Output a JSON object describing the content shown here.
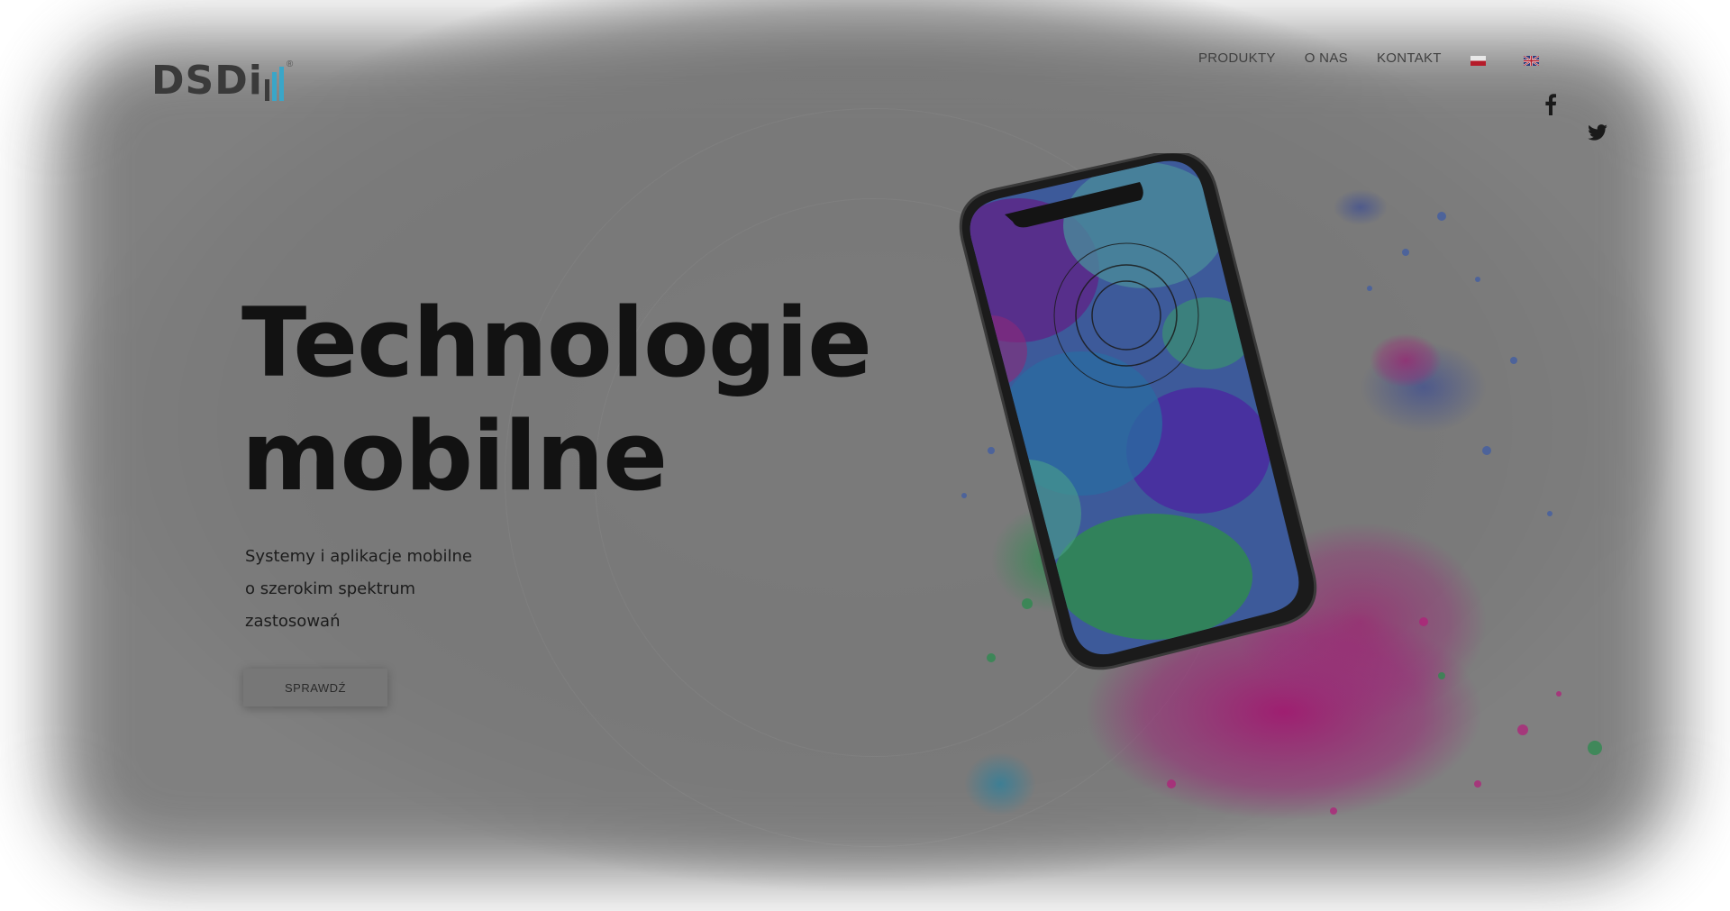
{
  "brand": {
    "logo_text": "DSDi",
    "reg_mark": "®"
  },
  "nav": {
    "items": [
      {
        "label": "PRODUKTY"
      },
      {
        "label": "O NAS"
      },
      {
        "label": "KONTAKT"
      }
    ],
    "languages": [
      "pl-flag-icon",
      "en-flag-icon"
    ]
  },
  "social": {
    "icons": [
      "facebook-icon",
      "twitter-icon"
    ]
  },
  "hero": {
    "headline_line1": "Technologie",
    "headline_line2": "mobilne",
    "subtitle_line1": "Systemy i aplikacje mobilne",
    "subtitle_line2": "o szerokim spektrum",
    "subtitle_line3": "zastosowań",
    "cta_label": "SPRAWDŹ"
  },
  "colors": {
    "overlay": "#7a7a7a",
    "headline": "#121212",
    "splash_magenta": "#b0207a",
    "splash_blue": "#2f4fa8",
    "splash_green": "#2e8a4e"
  }
}
